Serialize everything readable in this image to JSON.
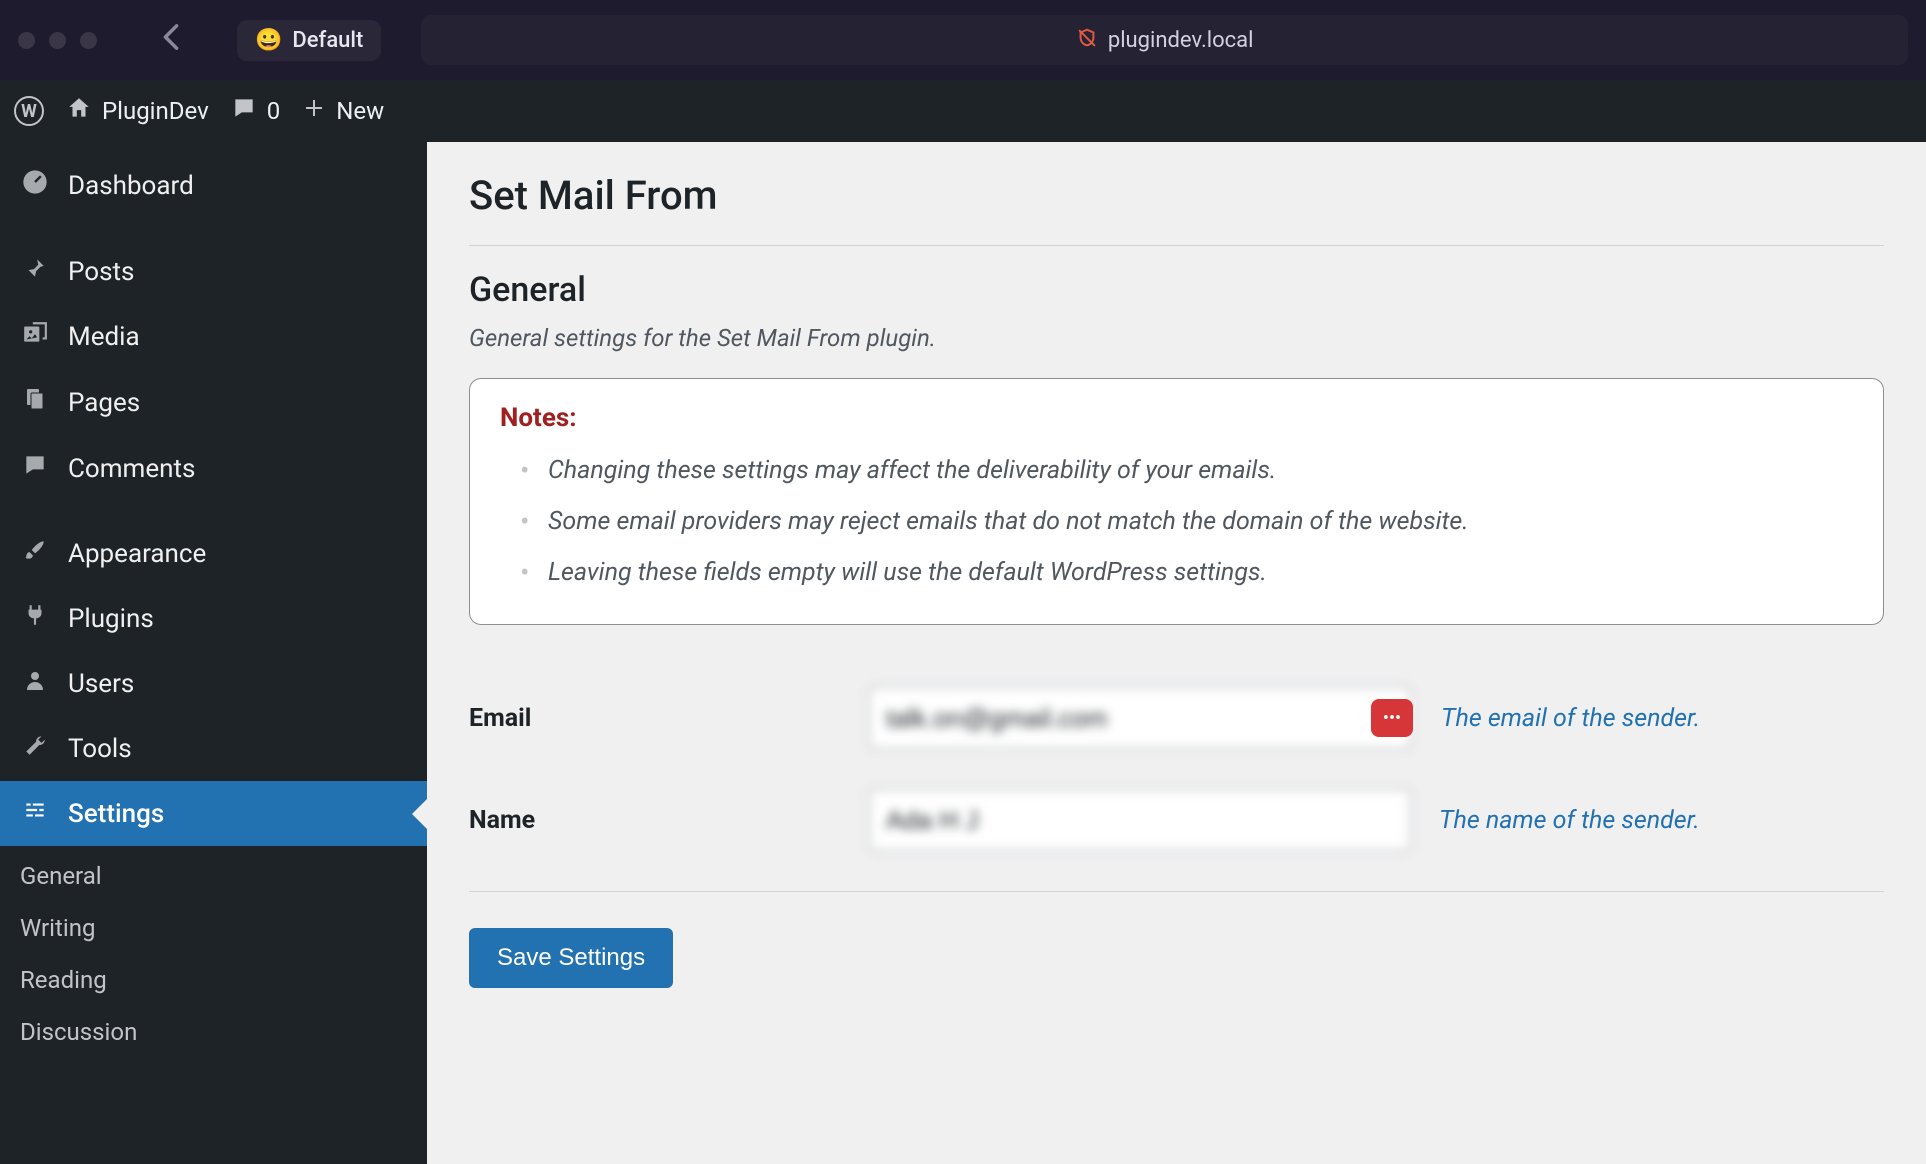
{
  "browser": {
    "profile_label": "Default",
    "url": "plugindev.local"
  },
  "adminbar": {
    "site_name": "PluginDev",
    "comments_count": "0",
    "new_label": "New"
  },
  "menu": {
    "items": [
      {
        "label": "Dashboard",
        "icon": "dashboard"
      },
      {
        "label": "Posts",
        "icon": "pin"
      },
      {
        "label": "Media",
        "icon": "media"
      },
      {
        "label": "Pages",
        "icon": "pages"
      },
      {
        "label": "Comments",
        "icon": "comment"
      },
      {
        "label": "Appearance",
        "icon": "brush"
      },
      {
        "label": "Plugins",
        "icon": "plug"
      },
      {
        "label": "Users",
        "icon": "user"
      },
      {
        "label": "Tools",
        "icon": "wrench"
      },
      {
        "label": "Settings",
        "icon": "sliders"
      }
    ],
    "submenu": [
      "General",
      "Writing",
      "Reading",
      "Discussion"
    ]
  },
  "page": {
    "title": "Set Mail From",
    "section_title": "General",
    "section_desc": "General settings for the Set Mail From plugin.",
    "notes_title": "Notes:",
    "notes": [
      "Changing these settings may affect the deliverability of your emails.",
      "Some email providers may reject emails that do not match the domain of the website.",
      "Leaving these fields empty will use the default WordPress settings."
    ],
    "fields": {
      "email": {
        "label": "Email",
        "value": "talk.on@gmail.com",
        "desc": "The email of the sender."
      },
      "name": {
        "label": "Name",
        "value": "Ada H J",
        "desc": "The name of the sender."
      }
    },
    "save_label": "Save Settings"
  }
}
